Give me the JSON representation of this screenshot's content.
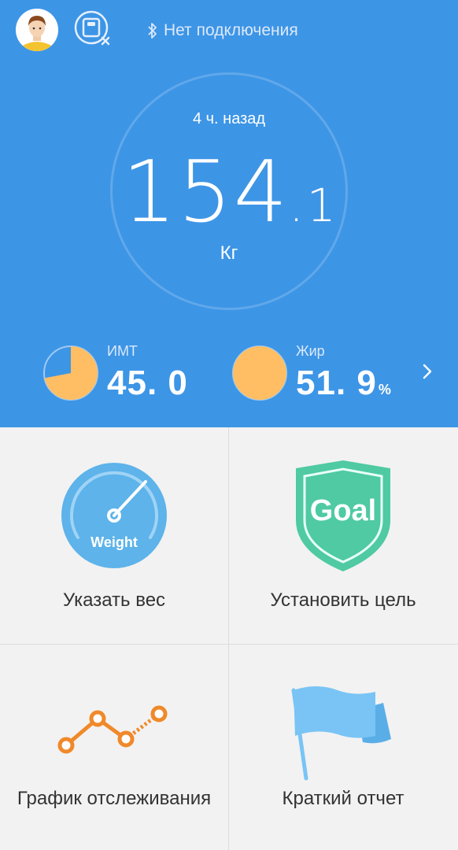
{
  "header": {
    "connection_status": "Нет подключения",
    "last_measured": "4 ч. назад",
    "weight_main": "154",
    "weight_decimal": "1",
    "unit": "Кг",
    "stats": [
      {
        "label": "ИМТ",
        "value": "45. 0",
        "fill_fraction": 0.72
      },
      {
        "label": "Жир",
        "value": "51. 9",
        "suffix": "%",
        "fill_fraction": 1.0
      }
    ]
  },
  "grid": {
    "items": [
      {
        "label": "Указать вес",
        "icon": "weight-gauge-icon",
        "icon_text": "Weight"
      },
      {
        "label": "Установить цель",
        "icon": "goal-shield-icon",
        "icon_text": "Goal"
      },
      {
        "label": "График отслеживания",
        "icon": "trend-chart-icon"
      },
      {
        "label": "Краткий отчет",
        "icon": "flag-icon"
      }
    ]
  },
  "colors": {
    "header_bg": "#3d95e6",
    "pie_fill": "#ffbe63",
    "goal_green": "#4fcaa2",
    "weight_blue": "#5db3ea",
    "chart_orange": "#f0892a",
    "flag_blue": "#79c4f5"
  }
}
